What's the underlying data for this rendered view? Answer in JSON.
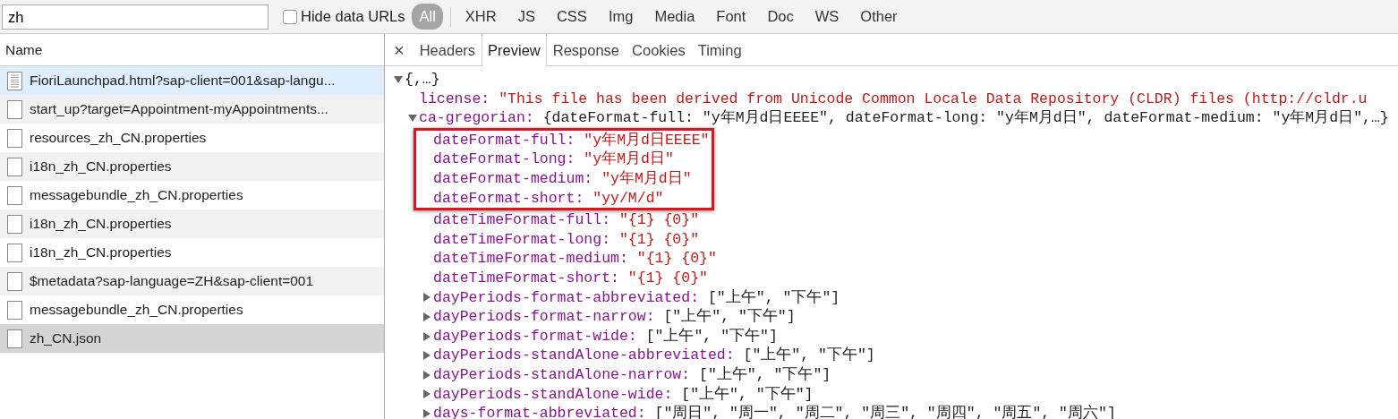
{
  "toolbar": {
    "filter_value": "zh",
    "hide_data_urls": {
      "label": "Hide data URLs",
      "checked": false
    },
    "types": [
      {
        "label": "All",
        "selected": true
      },
      {
        "label": "XHR",
        "selected": false
      },
      {
        "label": "JS",
        "selected": false
      },
      {
        "label": "CSS",
        "selected": false
      },
      {
        "label": "Img",
        "selected": false
      },
      {
        "label": "Media",
        "selected": false
      },
      {
        "label": "Font",
        "selected": false
      },
      {
        "label": "Doc",
        "selected": false
      },
      {
        "label": "WS",
        "selected": false
      },
      {
        "label": "Other",
        "selected": false
      }
    ]
  },
  "requests": {
    "column": "Name",
    "rows": [
      {
        "name": "FioriLaunchpad.html?sap-client=001&sap-langu...",
        "kind": "document",
        "hovered": true,
        "selected": false
      },
      {
        "name": "start_up?target=Appointment-myAppointments...",
        "kind": "blank",
        "hovered": false,
        "selected": false
      },
      {
        "name": "resources_zh_CN.properties",
        "kind": "blank",
        "hovered": false,
        "selected": false
      },
      {
        "name": "i18n_zh_CN.properties",
        "kind": "blank",
        "hovered": false,
        "selected": false
      },
      {
        "name": "messagebundle_zh_CN.properties",
        "kind": "blank",
        "hovered": false,
        "selected": false
      },
      {
        "name": "i18n_zh_CN.properties",
        "kind": "blank",
        "hovered": false,
        "selected": false
      },
      {
        "name": "i18n_zh_CN.properties",
        "kind": "blank",
        "hovered": false,
        "selected": false
      },
      {
        "name": "$metadata?sap-language=ZH&sap-client=001",
        "kind": "blank",
        "hovered": false,
        "selected": false
      },
      {
        "name": "messagebundle_zh_CN.properties",
        "kind": "blank",
        "hovered": false,
        "selected": false
      },
      {
        "name": "zh_CN.json",
        "kind": "blank",
        "hovered": false,
        "selected": true
      }
    ]
  },
  "detail": {
    "close": "×",
    "tabs": [
      {
        "label": "Headers",
        "selected": false
      },
      {
        "label": "Preview",
        "selected": true
      },
      {
        "label": "Response",
        "selected": false
      },
      {
        "label": "Cookies",
        "selected": false
      },
      {
        "label": "Timing",
        "selected": false
      }
    ],
    "preview": {
      "summary": "{,…}",
      "expanded": true,
      "children": [
        {
          "key": "license:",
          "value": "\"This file has been derived from Unicode Common Locale Data Repository (CLDR) files (http://cldr.u",
          "kind": "string"
        },
        {
          "key": "ca-gregorian:",
          "value": "{dateFormat-full: \"y年M月d日EEEE\", dateFormat-long: \"y年M月d日\", dateFormat-medium: \"y年M月d日\",…}",
          "kind": "object",
          "expanded": true,
          "children": [
            {
              "key": "dateFormat-full:",
              "value": "\"y年M月d日EEEE\"",
              "kind": "string",
              "highlighted": true
            },
            {
              "key": "dateFormat-long:",
              "value": "\"y年M月d日\"",
              "kind": "string",
              "highlighted": true
            },
            {
              "key": "dateFormat-medium:",
              "value": "\"y年M月d日\"",
              "kind": "string",
              "highlighted": true
            },
            {
              "key": "dateFormat-short:",
              "value": "\"yy/M/d\"",
              "kind": "string",
              "highlighted": true
            },
            {
              "key": "dateTimeFormat-full:",
              "value": "\"{1} {0}\"",
              "kind": "string",
              "highlighted": false
            },
            {
              "key": "dateTimeFormat-long:",
              "value": "\"{1} {0}\"",
              "kind": "string",
              "highlighted": false
            },
            {
              "key": "dateTimeFormat-medium:",
              "value": "\"{1} {0}\"",
              "kind": "string",
              "highlighted": false
            },
            {
              "key": "dateTimeFormat-short:",
              "value": "\"{1} {0}\"",
              "kind": "string",
              "highlighted": false
            },
            {
              "key": "dayPeriods-format-abbreviated:",
              "value": "[\"上午\", \"下午\"]",
              "kind": "object",
              "expanded": false,
              "highlighted": false
            },
            {
              "key": "dayPeriods-format-narrow:",
              "value": "[\"上午\", \"下午\"]",
              "kind": "object",
              "expanded": false,
              "highlighted": false
            },
            {
              "key": "dayPeriods-format-wide:",
              "value": "[\"上午\", \"下午\"]",
              "kind": "object",
              "expanded": false,
              "highlighted": false
            },
            {
              "key": "dayPeriods-standAlone-abbreviated:",
              "value": "[\"上午\", \"下午\"]",
              "kind": "object",
              "expanded": false,
              "highlighted": false
            },
            {
              "key": "dayPeriods-standAlone-narrow:",
              "value": "[\"上午\", \"下午\"]",
              "kind": "object",
              "expanded": false,
              "highlighted": false
            },
            {
              "key": "dayPeriods-standAlone-wide:",
              "value": "[\"上午\", \"下午\"]",
              "kind": "object",
              "expanded": false,
              "highlighted": false
            },
            {
              "key": "days-format-abbreviated:",
              "value": "[\"周日\", \"周一\", \"周二\", \"周三\", \"周四\", \"周五\", \"周六\"]",
              "kind": "object",
              "expanded": false,
              "highlighted": false
            }
          ]
        }
      ]
    }
  }
}
